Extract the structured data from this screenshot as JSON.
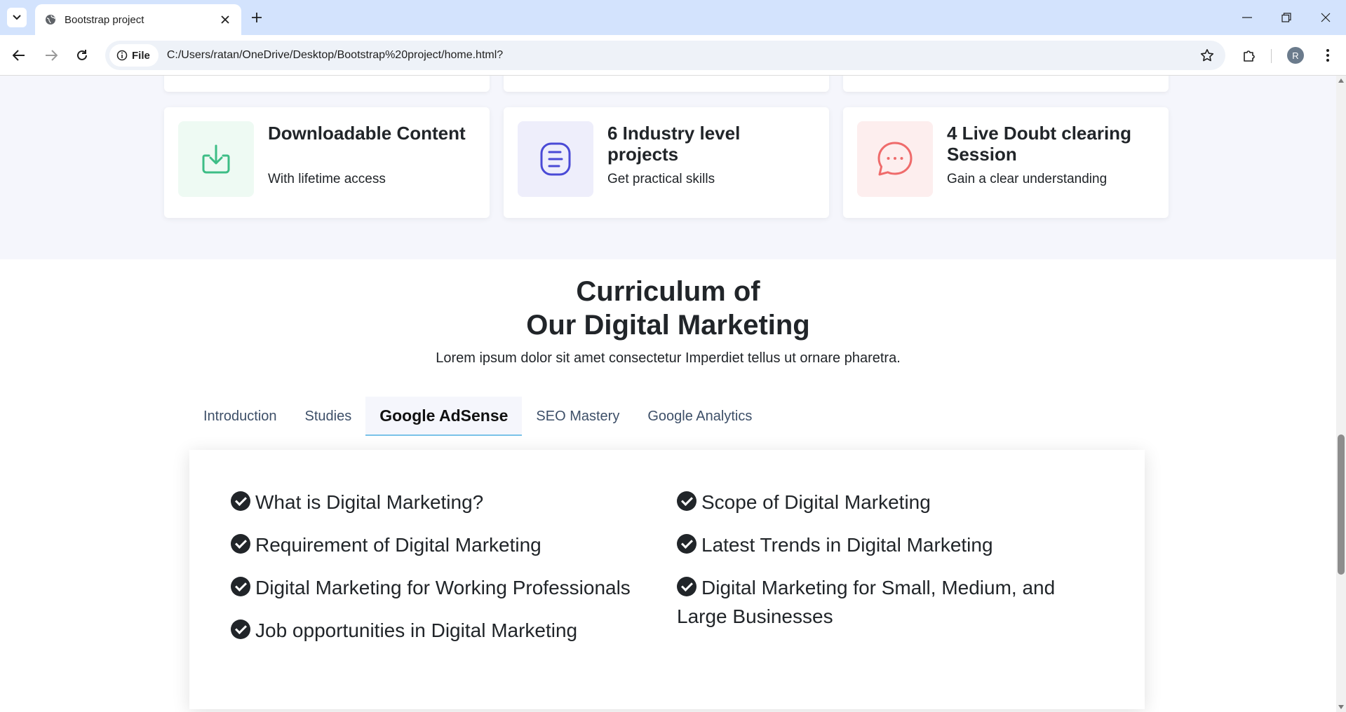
{
  "browser": {
    "tab_title": "Bootstrap project",
    "site_chip": "File",
    "url": "C:/Users/ratan/OneDrive/Desktop/Bootstrap%20project/home.html?",
    "profile_initial": "R"
  },
  "features": [
    {
      "title": "Downloadable Content",
      "subtitle": "With lifetime access",
      "icon": "download-icon",
      "color": "#3dbd86",
      "bg": "#eefaf3"
    },
    {
      "title": "6 Industry level projects",
      "subtitle": "Get practical skills",
      "icon": "document-icon",
      "color": "#4a4ad6",
      "bg": "#eeeefb"
    },
    {
      "title": "4 Live Doubt clearing Session",
      "subtitle": "Gain a clear understanding",
      "icon": "chat-bubble-icon",
      "color": "#ef6b6b",
      "bg": "#fdeeee"
    }
  ],
  "curriculum": {
    "title_line1": "Curriculum of",
    "title_line2": "Our Digital Marketing",
    "subtitle": "Lorem ipsum dolor sit amet consectetur Imperdiet tellus ut ornare pharetra.",
    "tabs": [
      "Introduction",
      "Studies",
      "Google AdSense",
      "SEO Mastery",
      "Google Analytics"
    ],
    "active_tab": "Google AdSense",
    "left_items": [
      "What is Digital Marketing?",
      "Requirement of Digital Marketing",
      "Digital Marketing for Working Professionals",
      "Job opportunities in Digital Marketing"
    ],
    "right_items": [
      "Scope of Digital Marketing",
      "Latest Trends in Digital Marketing",
      "Digital Marketing for Small, Medium, and Large Businesses"
    ]
  }
}
